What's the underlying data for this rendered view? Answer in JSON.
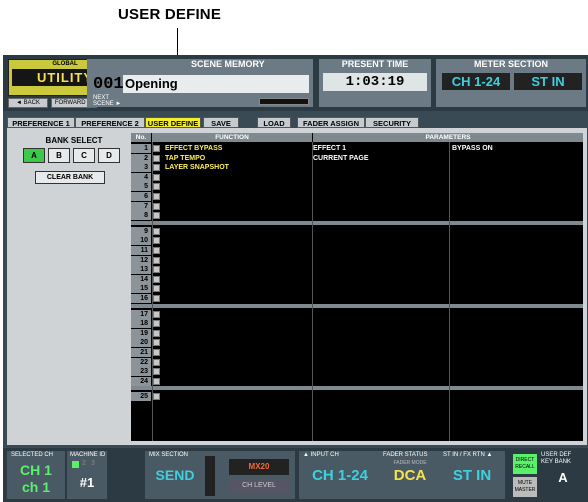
{
  "callout": "USER DEFINE",
  "global": {
    "label": "GLOBAL",
    "name": "UTILITY",
    "back": "◄ BACK",
    "forward": "FORWARD ►"
  },
  "scene": {
    "label": "SCENE MEMORY",
    "number": "001",
    "name": "Opening",
    "next": "NEXT\nSCENE ►"
  },
  "time": {
    "label": "PRESENT TIME",
    "value": "1:03:19"
  },
  "meter": {
    "label": "METER SECTION",
    "b1": "CH 1-24",
    "b2": "ST IN"
  },
  "tabs": [
    "PREFERENCE 1",
    "PREFERENCE 2",
    "USER DEFINE",
    "SAVE",
    "LOAD",
    "FADER ASSIGN",
    "SECURITY"
  ],
  "bank": {
    "label": "BANK SELECT",
    "buttons": [
      "A",
      "B",
      "C",
      "D"
    ],
    "clear": "CLEAR BANK"
  },
  "table": {
    "headers": {
      "no": "No.",
      "function": "FUNCTION",
      "parameters": "PARAMETERS"
    },
    "rows": [
      {
        "no": "1",
        "fn": "EFFECT BYPASS",
        "p1": "EFFECT 1",
        "p2": "BYPASS ON"
      },
      {
        "no": "2",
        "fn": "TAP TEMPO",
        "p1": "CURRENT PAGE",
        "p2": ""
      },
      {
        "no": "3",
        "fn": "LAYER SNAPSHOT",
        "p1": "",
        "p2": ""
      },
      {
        "no": "4",
        "fn": "",
        "p1": "",
        "p2": ""
      },
      {
        "no": "5",
        "fn": "",
        "p1": "",
        "p2": ""
      },
      {
        "no": "6",
        "fn": "",
        "p1": "",
        "p2": ""
      },
      {
        "no": "7",
        "fn": "",
        "p1": "",
        "p2": ""
      },
      {
        "no": "8",
        "fn": "",
        "p1": "",
        "p2": ""
      },
      {
        "no": "9",
        "fn": "",
        "p1": "",
        "p2": ""
      },
      {
        "no": "10",
        "fn": "",
        "p1": "",
        "p2": ""
      },
      {
        "no": "11",
        "fn": "",
        "p1": "",
        "p2": ""
      },
      {
        "no": "12",
        "fn": "",
        "p1": "",
        "p2": ""
      },
      {
        "no": "13",
        "fn": "",
        "p1": "",
        "p2": ""
      },
      {
        "no": "14",
        "fn": "",
        "p1": "",
        "p2": ""
      },
      {
        "no": "15",
        "fn": "",
        "p1": "",
        "p2": ""
      },
      {
        "no": "16",
        "fn": "",
        "p1": "",
        "p2": ""
      },
      {
        "no": "17",
        "fn": "",
        "p1": "",
        "p2": ""
      },
      {
        "no": "18",
        "fn": "",
        "p1": "",
        "p2": ""
      },
      {
        "no": "19",
        "fn": "",
        "p1": "",
        "p2": ""
      },
      {
        "no": "20",
        "fn": "",
        "p1": "",
        "p2": ""
      },
      {
        "no": "21",
        "fn": "",
        "p1": "",
        "p2": ""
      },
      {
        "no": "22",
        "fn": "",
        "p1": "",
        "p2": ""
      },
      {
        "no": "23",
        "fn": "",
        "p1": "",
        "p2": ""
      },
      {
        "no": "24",
        "fn": "",
        "p1": "",
        "p2": ""
      },
      {
        "no": "25",
        "fn": "",
        "p1": "",
        "p2": ""
      }
    ]
  },
  "footer": {
    "sel_label": "SELECTED CH",
    "sel_ch": "CH 1",
    "sel_name": "ch 1",
    "mach_label": "MACHINE ID",
    "mach_val": "#1",
    "mach_n2": "2",
    "mach_n3": "3",
    "mix_label": "MIX SECTION",
    "mix_send": "SEND",
    "mix_name": "MX20",
    "ch_level": "CH LEVEL",
    "input_label": "▲ INPUT CH",
    "input_val": "CH 1-24",
    "fader_label": "FADER STATUS",
    "fader_mode": "FADER MODE",
    "fader_val": "DCA",
    "stin_label": "ST IN / FX RTN ▲",
    "stin_val": "ST IN",
    "direct": "DIRECT\nRECALL",
    "mute": "MUTE\nMASTER",
    "ukb_label": "USER DEF\nKEY BANK",
    "ukb_val": "A"
  }
}
